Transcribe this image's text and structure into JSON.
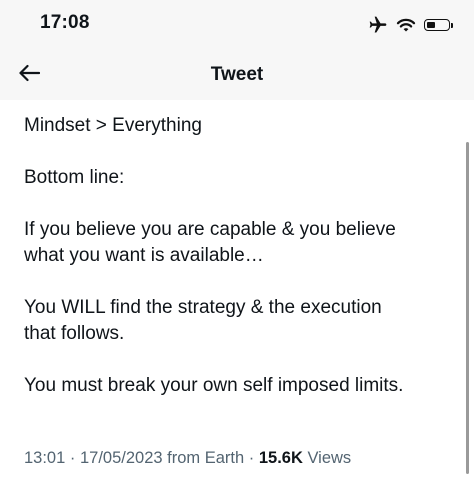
{
  "status_bar": {
    "time": "17:08",
    "icons": [
      "airplane-icon",
      "wifi-icon",
      "battery-icon"
    ]
  },
  "nav": {
    "back_icon": "back-arrow-icon",
    "title": "Tweet"
  },
  "tweet": {
    "lines": [
      "Mindset > Everything",
      "",
      "Bottom line:",
      "",
      "If you believe you are capable & you believe",
      "what you want is available…",
      "",
      "You WILL find the strategy & the execution",
      "that follows.",
      "",
      "You must break your own self imposed limits."
    ],
    "meta": {
      "time": "13:01",
      "separator": " · ",
      "date": "17/05/2023",
      "source": " from Earth",
      "views_count": "15.6K",
      "views_label": " Views"
    }
  },
  "colors": {
    "text": "#0f1419",
    "secondary_text": "#536471",
    "header_background": "#f7f7f7"
  }
}
